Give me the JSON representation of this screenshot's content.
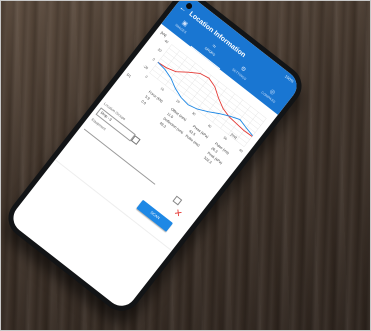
{
  "statusbar": {
    "battery": "100%"
  },
  "appbar": {
    "title": "Location Information"
  },
  "tabs": [
    {
      "label": "IMAGES",
      "icon": "image-icon"
    },
    {
      "label": "DROPS",
      "icon": "drops-icon",
      "active": true
    },
    {
      "label": "SETTINGS",
      "icon": "gear-icon"
    },
    {
      "label": "COMPASS",
      "icon": "compass-icon"
    }
  ],
  "chart": {
    "y_label": "[kN]",
    "x_label": "[ms]",
    "y_ticks": [
      "40",
      "20",
      "0",
      "-20"
    ],
    "x_ticks": [
      "0",
      "10",
      "20",
      "30",
      "40",
      "50",
      "60"
    ],
    "colors": {
      "force": "#e53935",
      "deflection": "#1e88e5",
      "grid": "#d6d6d6"
    }
  },
  "chart_data": {
    "type": "line",
    "x": [
      0,
      5,
      10,
      15,
      20,
      25,
      30,
      35,
      40,
      45,
      50,
      55,
      60
    ],
    "series": [
      {
        "values": [
          0,
          2,
          8,
          24,
          38,
          42,
          35,
          20,
          8,
          2,
          0,
          -2,
          -1
        ]
      },
      {
        "values": [
          0,
          -3,
          -10,
          -22,
          -30,
          -33,
          -28,
          -18,
          -6,
          4,
          12,
          6,
          1
        ]
      }
    ],
    "xlim": [
      0,
      60
    ],
    "ylim": [
      -30,
      50
    ],
    "grid": true
  },
  "props": {
    "headers": [
      "Force (kN)",
      "Offset (mm)",
      "Press (kPa)",
      "Pulse (ms)"
    ],
    "drop_label": "D1",
    "row1": [
      "3.9",
      "11.9",
      "42.5",
      "26.3"
    ],
    "row2": [
      "0.0",
      "Deflection (um)",
      "Pulse (ms)",
      "Peak (kPa)"
    ],
    "row3": [
      "",
      "49.3",
      "",
      "322.3"
    ]
  },
  "location_group_label": "Location Groups",
  "group_value": "Drop - 3",
  "equipment_label": "Equipment",
  "scan_label": "SCAN"
}
